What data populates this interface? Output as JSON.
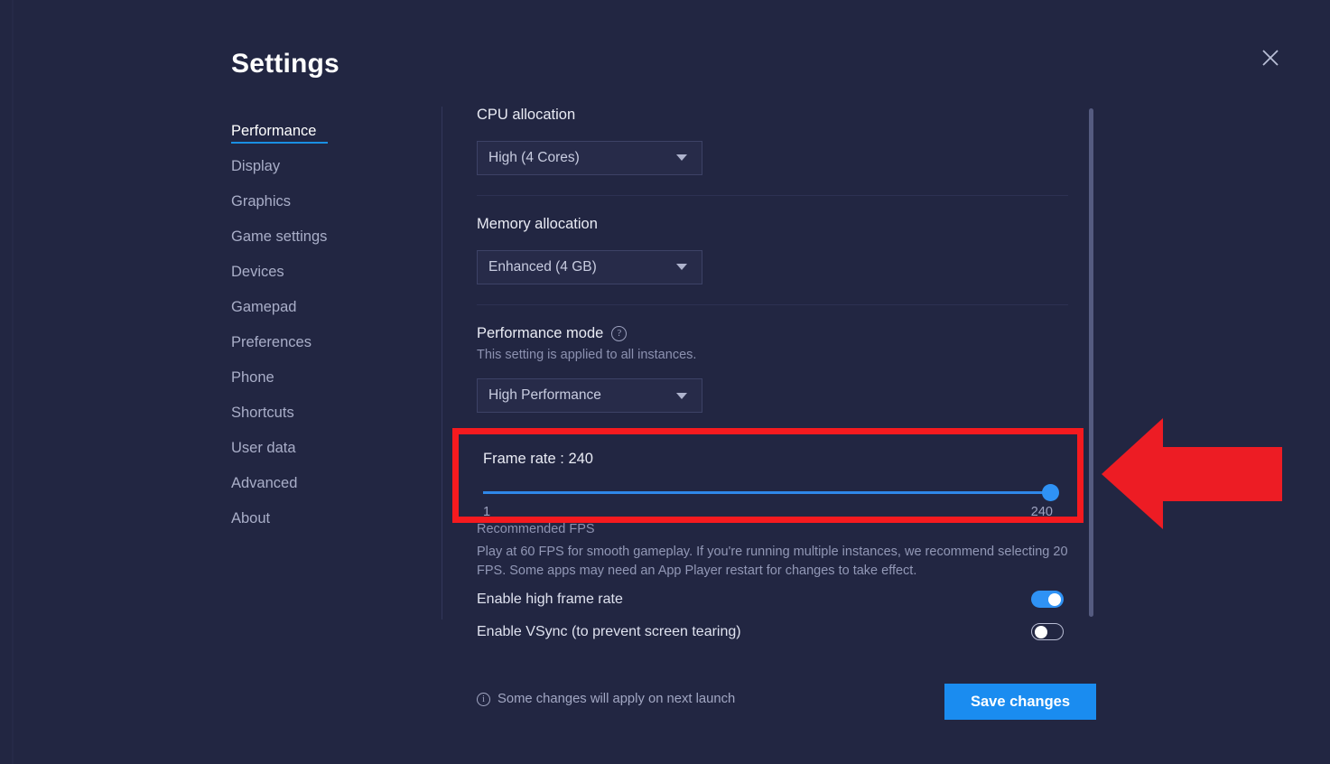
{
  "window": {
    "title": "Settings",
    "close_icon": "close-icon"
  },
  "sidebar": {
    "items": [
      {
        "label": "Performance",
        "active": true
      },
      {
        "label": "Display",
        "active": false
      },
      {
        "label": "Graphics",
        "active": false
      },
      {
        "label": "Game settings",
        "active": false
      },
      {
        "label": "Devices",
        "active": false
      },
      {
        "label": "Gamepad",
        "active": false
      },
      {
        "label": "Preferences",
        "active": false
      },
      {
        "label": "Phone",
        "active": false
      },
      {
        "label": "Shortcuts",
        "active": false
      },
      {
        "label": "User data",
        "active": false
      },
      {
        "label": "Advanced",
        "active": false
      },
      {
        "label": "About",
        "active": false
      }
    ]
  },
  "main": {
    "cpu": {
      "label": "CPU allocation",
      "value": "High (4 Cores)"
    },
    "memory": {
      "label": "Memory allocation",
      "value": "Enhanced (4 GB)"
    },
    "performance_mode": {
      "label": "Performance mode",
      "help_icon": "question-mark-icon",
      "note": "This setting is applied to all instances.",
      "value": "High Performance"
    },
    "frame_rate": {
      "title": "Frame rate : 240",
      "value": 240,
      "min_label": "1",
      "max_label": "240",
      "min": 1,
      "max": 240,
      "highlight_color": "#f51a1f"
    },
    "fps_help": {
      "heading": "Recommended FPS",
      "body": "Play at 60 FPS for smooth gameplay. If you're running multiple instances, we recommend selecting 20 FPS. Some apps may need an App Player restart for changes to take effect."
    },
    "toggles": [
      {
        "label": "Enable high frame rate",
        "on": true
      },
      {
        "label": "Enable VSync (to prevent screen tearing)",
        "on": false
      }
    ]
  },
  "footer": {
    "info_icon": "info-icon",
    "note": "Some changes will apply on next launch",
    "save_label": "Save changes",
    "save_color": "#1a8cf0"
  },
  "annotation": {
    "arrow": "left-arrow-annotation",
    "color": "#ed1c24"
  },
  "theme": {
    "background": "#222642",
    "accent": "#1a8cf0",
    "text": "#e9ebf4"
  }
}
